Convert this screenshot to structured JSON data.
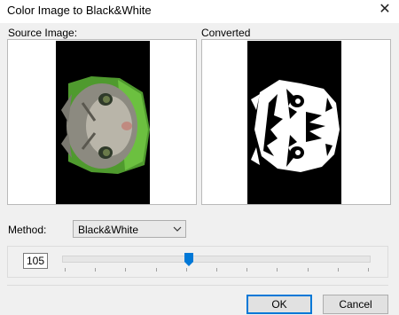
{
  "window": {
    "title": "Color Image to Black&White",
    "close_glyph": "✕"
  },
  "source": {
    "label": "Source Image:"
  },
  "converted": {
    "label": "Converted"
  },
  "method": {
    "label": "Method:",
    "selected": "Black&White"
  },
  "threshold": {
    "value": "105",
    "slider_fraction": 0.41
  },
  "buttons": {
    "ok": "OK",
    "cancel": "Cancel"
  },
  "colors": {
    "accent": "#0078d7",
    "image_bg": "#000000"
  }
}
